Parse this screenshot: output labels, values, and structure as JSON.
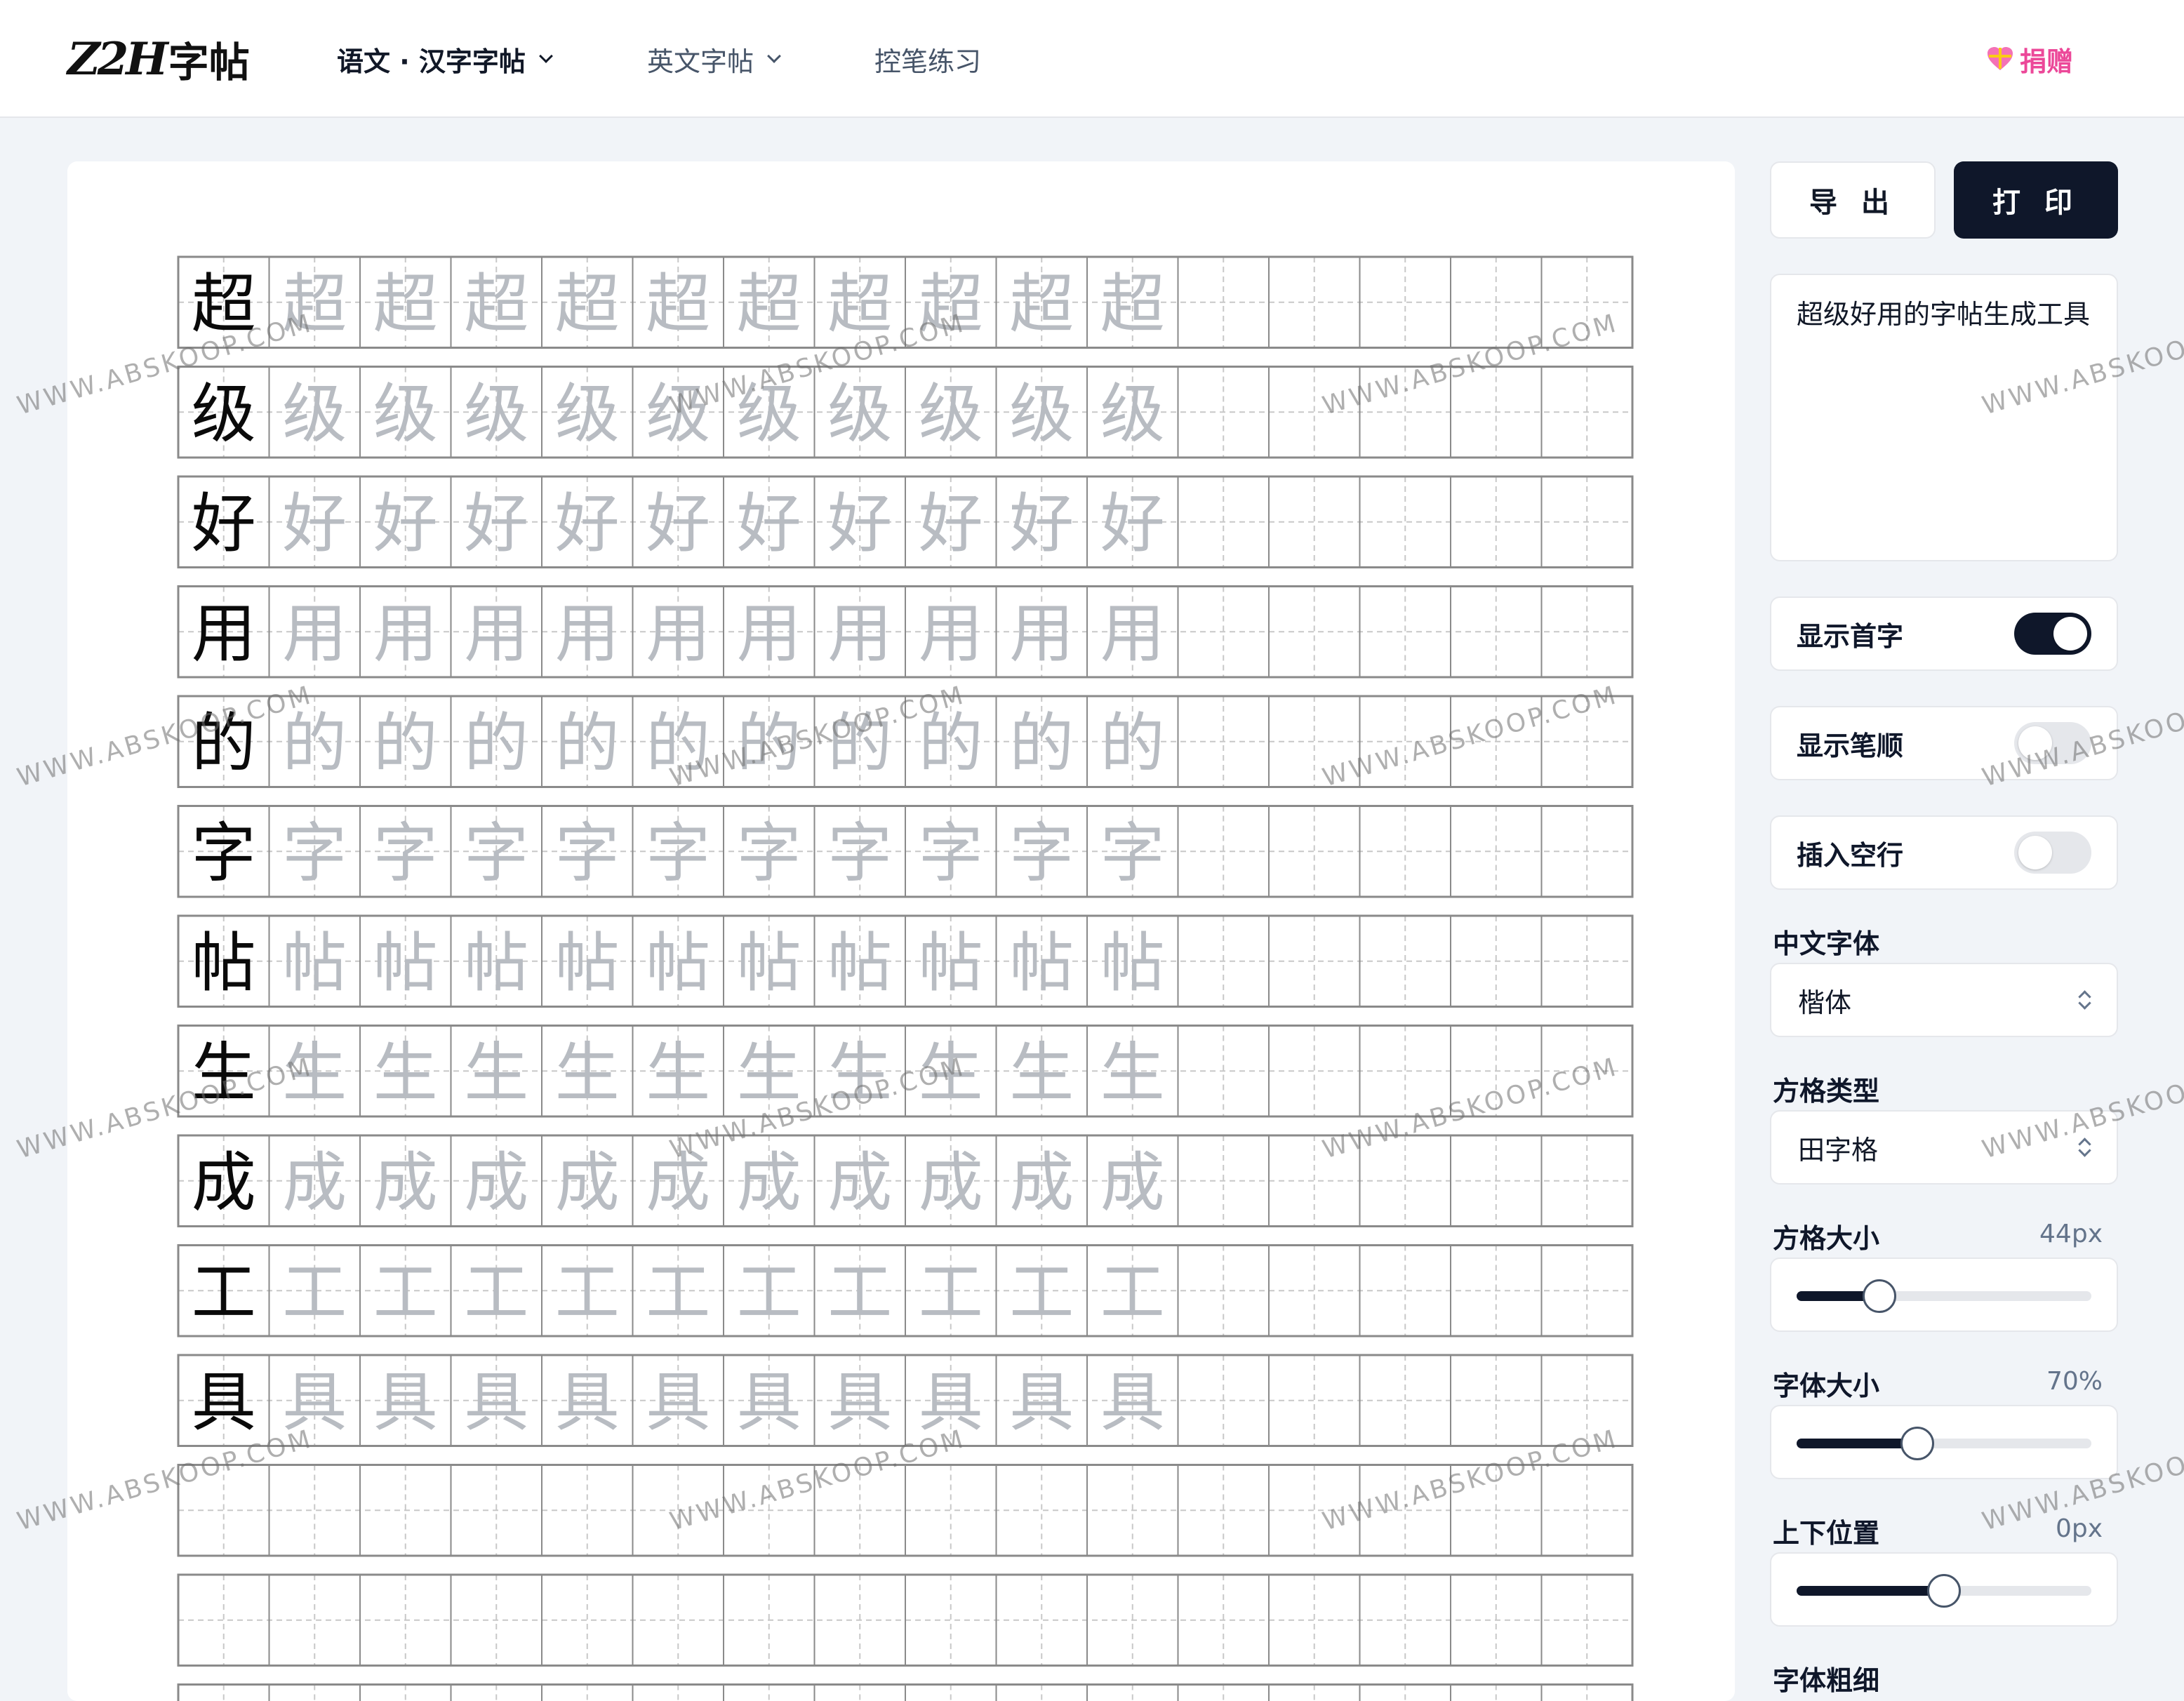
{
  "header": {
    "logo_latin": "Z2H",
    "logo_cn": "字帖",
    "nav": [
      {
        "label": "语文 · 汉字字帖"
      },
      {
        "label": "英文字帖"
      },
      {
        "label": "控笔练习"
      }
    ],
    "donate_label": "捐赠"
  },
  "toolbar": {
    "export_label": "导 出",
    "print_label": "打 印"
  },
  "input_text": "超级好用的字帖生成工具",
  "grid": {
    "characters": [
      "超",
      "级",
      "好",
      "用",
      "的",
      "字",
      "帖",
      "生",
      "成",
      "工",
      "具"
    ],
    "columns": 16,
    "trace_count": 10,
    "total_rows": 14,
    "cell_type": "田字格"
  },
  "settings": {
    "show_first_char": {
      "label": "显示首字",
      "on": true
    },
    "show_stroke_order": {
      "label": "显示笔顺",
      "on": false
    },
    "insert_blank_row": {
      "label": "插入空行",
      "on": false
    },
    "chinese_font": {
      "label": "中文字体",
      "value": "楷体"
    },
    "grid_type": {
      "label": "方格类型",
      "value": "田字格"
    },
    "grid_size": {
      "label": "方格大小",
      "value": "44px",
      "level": 0.28
    },
    "font_size": {
      "label": "字体大小",
      "value": "70%",
      "level": 0.41
    },
    "vertical_position": {
      "label": "上下位置",
      "value": "0px",
      "level": 0.5
    },
    "font_weight": {
      "label": "字体粗细"
    }
  },
  "watermark_text": "WWW.ABSKOOP.COM",
  "colors": {
    "accent": "#0f172a",
    "donate": "#ec4899",
    "trace_char": "#b8bcc2",
    "grid_line": "#8a8a8a",
    "guide_line": "#c8c8c8"
  }
}
